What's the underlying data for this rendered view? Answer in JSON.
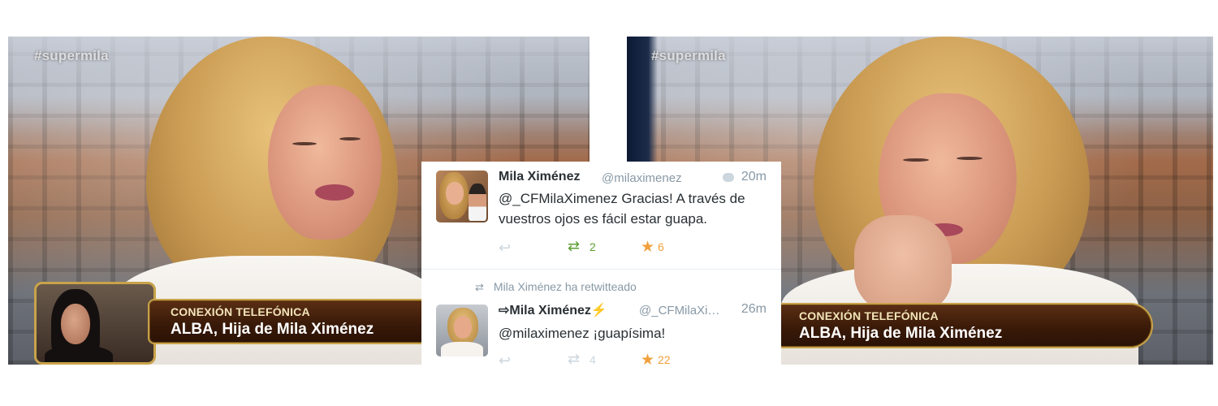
{
  "left_frame": {
    "hashtag": "#supermila",
    "lower_third": {
      "line1": "CONEXIÓN TELEFÓNICA",
      "line2": "ALBA, Hija de Mila Ximénez"
    }
  },
  "right_frame": {
    "hashtag": "#supermila",
    "lower_third": {
      "line1": "CONEXIÓN TELEFÓNICA",
      "line2": "ALBA, Hija de Mila Ximénez"
    }
  },
  "tweets": [
    {
      "name": "Mila Ximénez",
      "handle": "@milaximenez",
      "time": "20m",
      "text": "@_CFMilaXimenez Gracias! A través de vuestros ojos es fácil estar guapa.",
      "retweets": "2",
      "favorites": "6",
      "retweeted_by_me": true
    },
    {
      "retweet_notice": "Mila Ximénez ha retwitteado",
      "name_prefix": "⇨",
      "name": "Mila Ximénez",
      "name_suffix": "⚡",
      "handle": "@_CFMilaXi…",
      "time": "26m",
      "text": "@milaximenez ¡guapísima!",
      "retweets": "4",
      "favorites": "22",
      "retweeted_by_me": false
    }
  ],
  "colors": {
    "twitter_gray": "#8899a6",
    "retweet_green": "#5c9e31",
    "favorite_orange": "#f0a03c",
    "lower_third_gold": "#c9a24a"
  }
}
